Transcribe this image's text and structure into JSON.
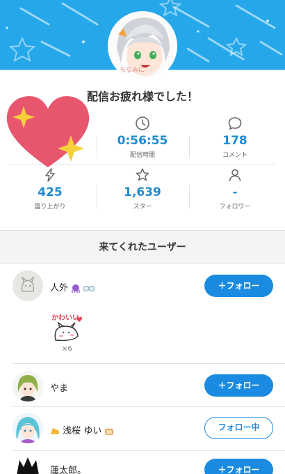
{
  "banner": {
    "color": "#25a7ea"
  },
  "title": "配信お疲れ様でした！",
  "stats": [
    {
      "icon": "heart-icon",
      "value": "",
      "label": ""
    },
    {
      "icon": "clock-icon",
      "value": "0:56:55",
      "label": "配信時間"
    },
    {
      "icon": "comment-icon",
      "value": "178",
      "label": "コメント"
    },
    {
      "icon": "lightning-icon",
      "value": "425",
      "label": "盛り上がり"
    },
    {
      "icon": "star-icon",
      "value": "1,639",
      "label": "スター"
    },
    {
      "icon": "person-icon",
      "value": "-",
      "label": "フォロワー"
    }
  ],
  "section_title": "来てくれたユーザー",
  "users": [
    {
      "name": "人外",
      "button": "＋フォロー",
      "following": false,
      "sticker_text": "かわいい",
      "sticker_count": "×6"
    },
    {
      "name": "やま",
      "button": "＋フォロー",
      "following": false
    },
    {
      "name": "浅桜 ゆい",
      "button": "フォロー中",
      "following": true
    },
    {
      "name": "蓮太郎。",
      "button": "＋フォロー",
      "following": false
    }
  ],
  "colors": {
    "accent": "#1a8be0",
    "value_blue": "#1f8bd2",
    "heart": "#e8566e",
    "sparkle": "#f6cf3a"
  }
}
